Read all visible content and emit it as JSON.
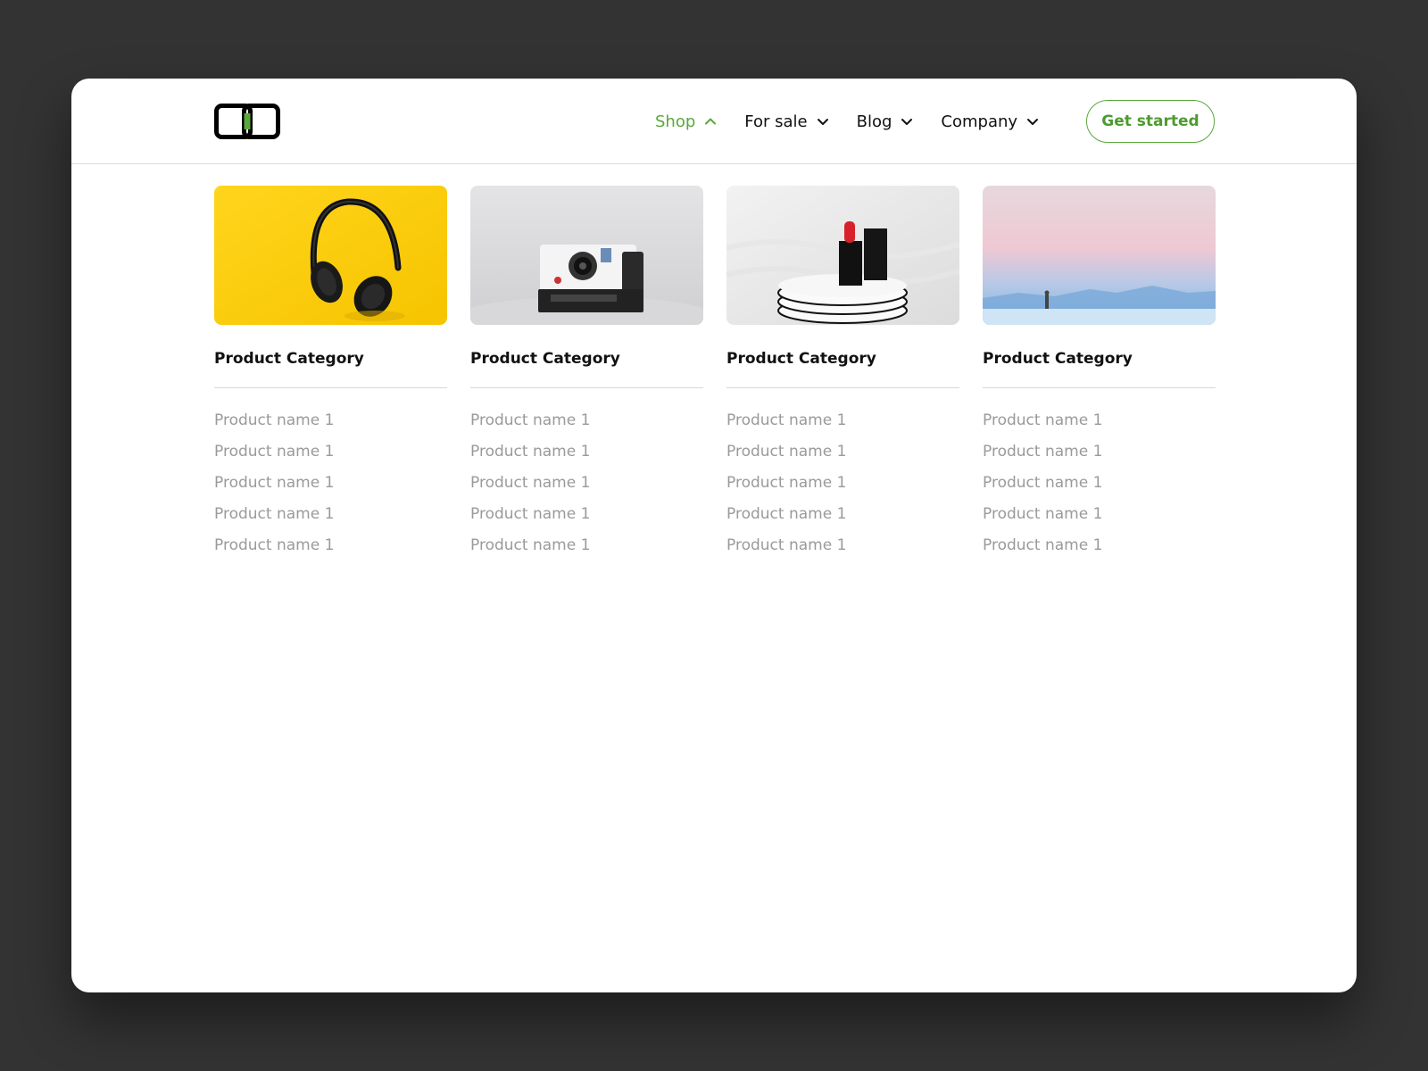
{
  "brand": {
    "accent_color": "#5aa83a",
    "logo_icon": "linked-rings-logo-icon"
  },
  "nav": {
    "items": [
      {
        "label": "Shop",
        "active": true,
        "chevron": "chevron-up-icon"
      },
      {
        "label": "For sale",
        "active": false,
        "chevron": "chevron-down-icon"
      },
      {
        "label": "Blog",
        "active": false,
        "chevron": "chevron-down-icon"
      },
      {
        "label": "Company",
        "active": false,
        "chevron": "chevron-down-icon"
      }
    ],
    "cta_label": "Get started"
  },
  "categories": [
    {
      "title": "Product Category",
      "image": "headphones-on-yellow",
      "products": [
        "Product name 1",
        "Product name 1",
        "Product name 1",
        "Product name 1",
        "Product name 1"
      ]
    },
    {
      "title": "Product Category",
      "image": "instant-camera",
      "products": [
        "Product name 1",
        "Product name 1",
        "Product name 1",
        "Product name 1",
        "Product name 1"
      ]
    },
    {
      "title": "Product Category",
      "image": "lipstick-on-pedestal",
      "products": [
        "Product name 1",
        "Product name 1",
        "Product name 1",
        "Product name 1",
        "Product name 1"
      ]
    },
    {
      "title": "Product Category",
      "image": "pastel-landscape",
      "products": [
        "Product name 1",
        "Product name 1",
        "Product name 1",
        "Product name 1",
        "Product name 1"
      ]
    }
  ]
}
